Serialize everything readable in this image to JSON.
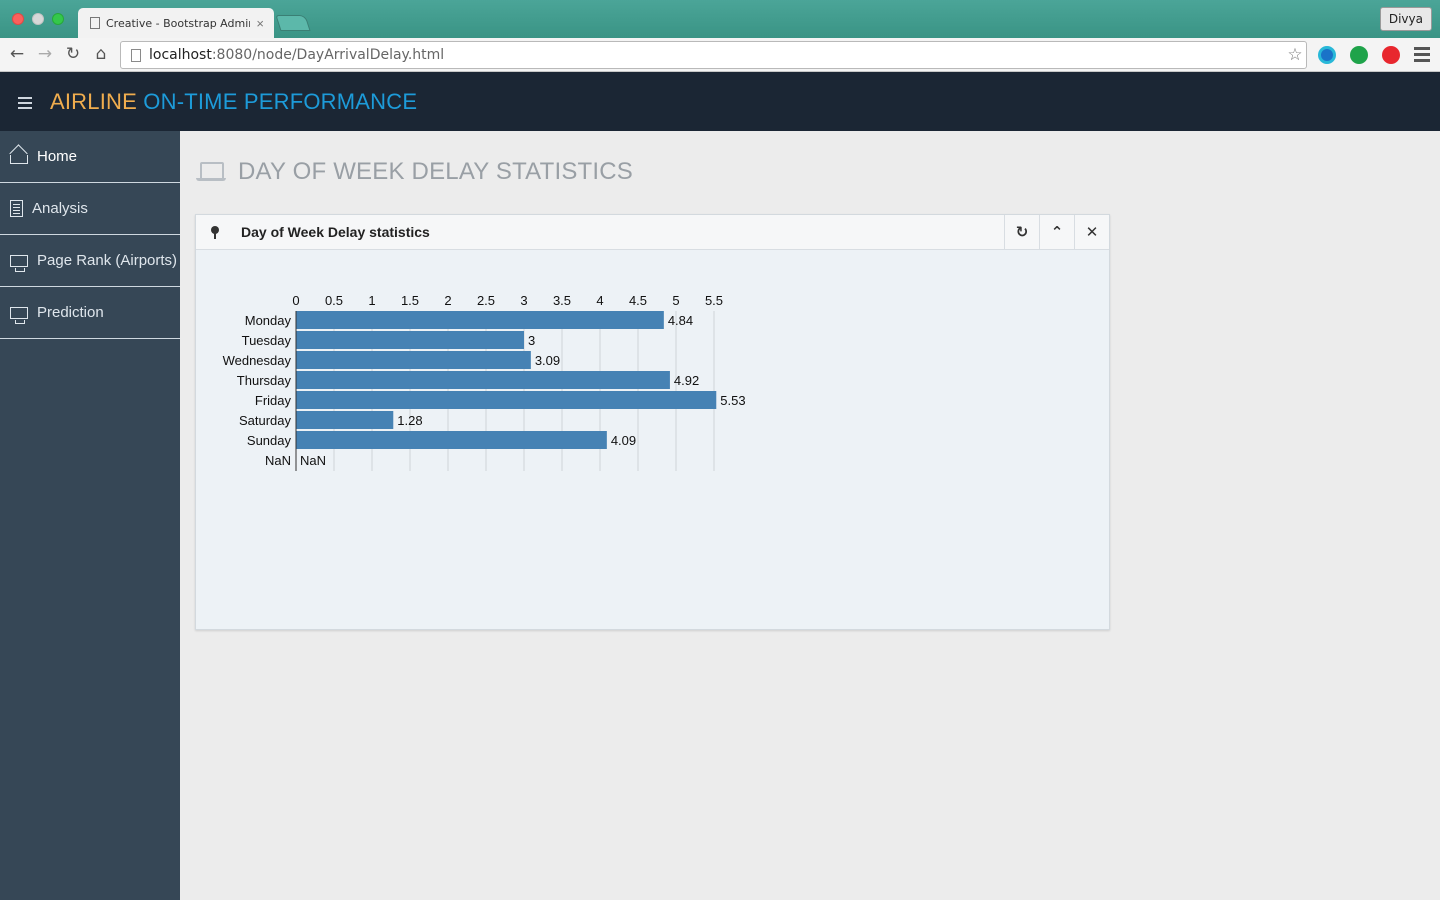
{
  "browser": {
    "tab_title": "Creative - Bootstrap Admin",
    "tab_close": "×",
    "profile": "Divya",
    "url_host": "localhost",
    "url_rest": ":8080/node/DayArrivalDelay.html",
    "icons": [
      "back-icon",
      "forward-icon",
      "reload-icon",
      "home-icon",
      "star-icon",
      "menu-icon"
    ]
  },
  "app": {
    "brand_part1": "AIRLINE",
    "brand_part2": "ON-TIME PERFORMANCE",
    "brand_colors": {
      "part1": "#f0ad4e",
      "part2": "#1d9bd9"
    }
  },
  "sidebar": {
    "items": [
      {
        "label": "Home",
        "icon": "home-icon"
      },
      {
        "label": "Analysis",
        "icon": "document-icon"
      },
      {
        "label": "Page Rank (Airports)",
        "icon": "monitor-icon"
      },
      {
        "label": "Prediction",
        "icon": "monitor-icon"
      }
    ]
  },
  "main": {
    "page_title": "DAY OF WEEK DELAY STATISTICS",
    "panel": {
      "title": "Day of Week Delay statistics",
      "buttons": [
        "refresh-icon",
        "collapse-icon",
        "close-icon"
      ]
    }
  },
  "chart_data": {
    "type": "bar",
    "orientation": "horizontal",
    "categories": [
      "Monday",
      "Tuesday",
      "Wednesday",
      "Thursday",
      "Friday",
      "Saturday",
      "Sunday",
      "NaN"
    ],
    "values": [
      4.84,
      3,
      3.09,
      4.92,
      5.53,
      1.28,
      4.09,
      null
    ],
    "value_labels": [
      "4.84",
      "3",
      "3.09",
      "4.92",
      "5.53",
      "1.28",
      "4.09",
      "NaN"
    ],
    "x_ticks": [
      "0",
      "0.5",
      "1",
      "1.5",
      "2",
      "2.5",
      "3",
      "3.5",
      "4",
      "4.5",
      "5",
      "5.5"
    ],
    "xlim": [
      0,
      5.5
    ],
    "axis_position": "top",
    "grid": true,
    "bar_color": "#4682b4",
    "title": "",
    "xlabel": "",
    "ylabel": ""
  }
}
